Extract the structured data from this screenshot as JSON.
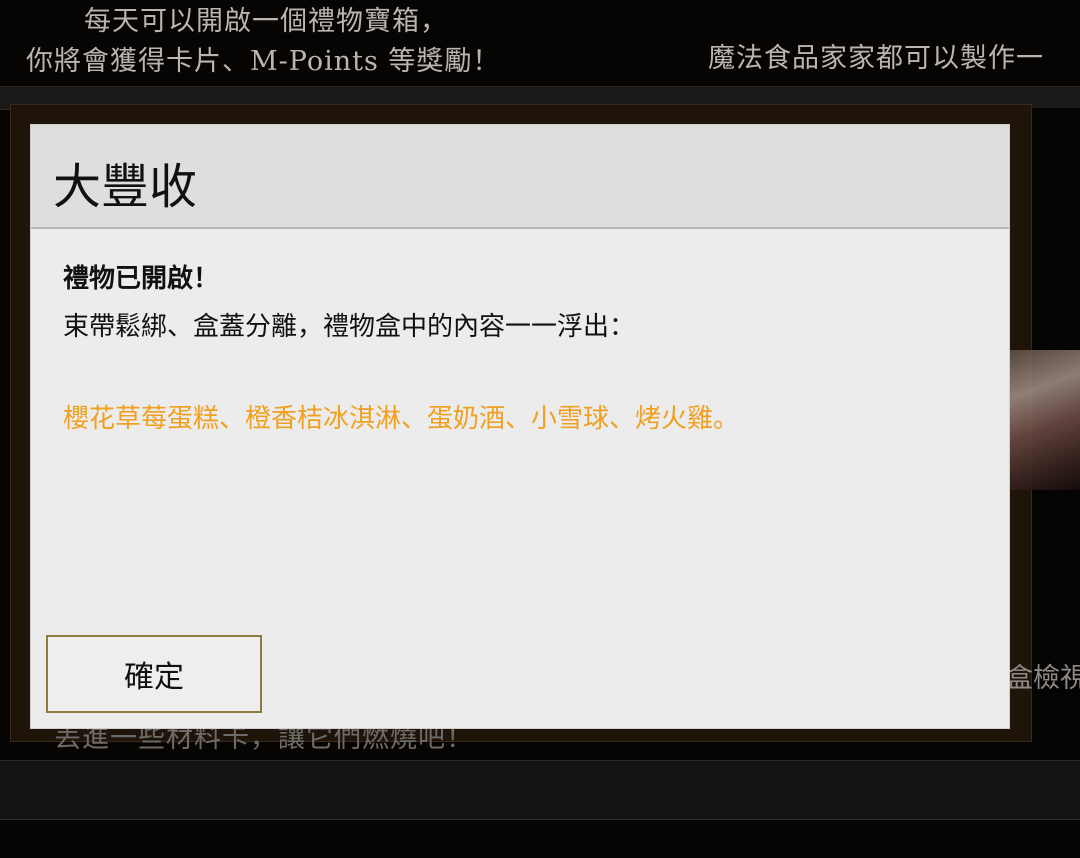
{
  "background": {
    "top_left_line1": "每天可以開啟一個禮物寶箱，",
    "top_left_line2": "你將會獲得卡片、M-Points 等獎勵！",
    "top_right_text": "魔法食品家家都可以製作一",
    "right_side_text": "盒檢視",
    "bottom_text": "丟進一些材料卡，讓它們燃燒吧！"
  },
  "dialog": {
    "title": "大豐收",
    "heading": "禮物已開啟！",
    "description": "束帶鬆綁、盒蓋分離，禮物盒中的內容一一浮出：",
    "items_text": "櫻花草莓蛋糕、橙香桔冰淇淋、蛋奶酒、小雪球、烤火雞。",
    "confirm_label": "確定"
  },
  "colors": {
    "item_highlight": "#f0a020",
    "button_border": "#8d7a3e",
    "dialog_bg": "#ececec",
    "header_bg": "#dedede"
  }
}
